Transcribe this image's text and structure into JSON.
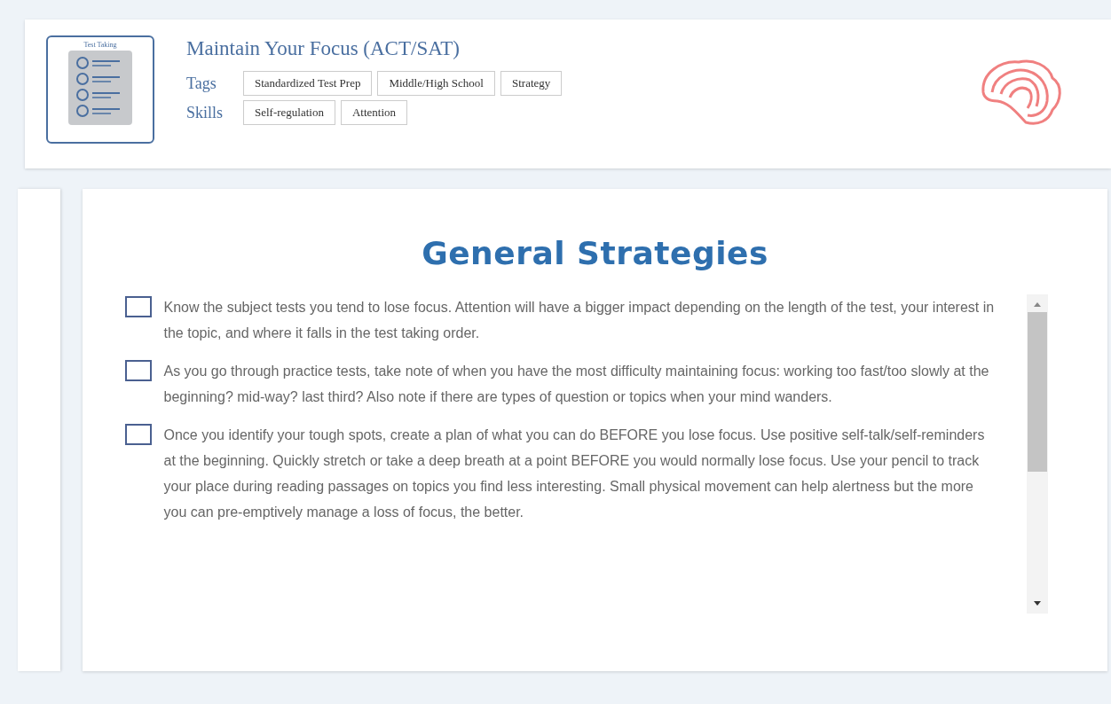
{
  "header": {
    "thumbnail_label": "Test Taking",
    "title": "Maintain Your Focus (ACT/SAT)",
    "tag_groups": [
      {
        "label": "Tags",
        "items": [
          "Standardized Test Prep",
          "Middle/High School",
          "Strategy"
        ]
      },
      {
        "label": "Skills",
        "items": [
          "Self-regulation",
          "Attention"
        ]
      }
    ]
  },
  "content": {
    "heading": "General Strategies",
    "items": [
      {
        "checked": false,
        "text": "Know the subject tests you tend to lose focus. Attention will have a bigger impact depending on the length of the test, your interest in the topic, and where it falls in the test taking order."
      },
      {
        "checked": false,
        "text": "As you go through practice tests, take note of when you have the most difficulty maintaining focus: working too fast/too slowly at the beginning? mid-way? last third? Also note if there are types of question or topics when your mind wanders."
      },
      {
        "checked": false,
        "text": "Once you identify your tough spots, create a plan of what you can do BEFORE you lose focus. Use positive self-talk/self-reminders at the beginning. Quickly stretch or take a deep breath at a point BEFORE you would normally lose focus. Use your pencil to track your place during reading passages on topics you find less interesting. Small physical movement can help alertness but the more you can pre-emptively manage a loss of focus, the better."
      }
    ]
  }
}
